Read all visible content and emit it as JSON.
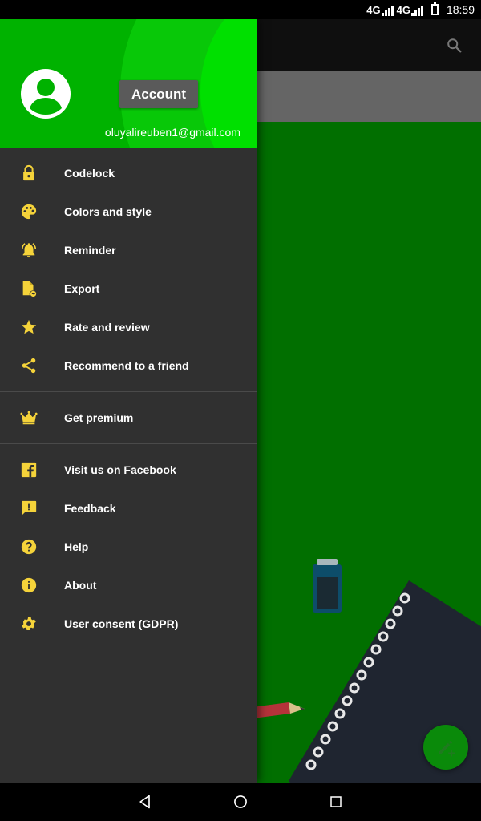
{
  "status_bar": {
    "network1": "4G",
    "network2": "4G",
    "time": "18:59"
  },
  "account": {
    "button_label": "Account",
    "email": "oluyalireuben1@gmail.com"
  },
  "menu": {
    "group1": [
      {
        "label": "Codelock",
        "icon": "lock-icon"
      },
      {
        "label": "Colors and style",
        "icon": "palette-icon"
      },
      {
        "label": "Reminder",
        "icon": "bell-icon"
      },
      {
        "label": "Export",
        "icon": "export-file-icon"
      },
      {
        "label": "Rate and review",
        "icon": "star-icon"
      },
      {
        "label": "Recommend to a friend",
        "icon": "share-icon"
      }
    ],
    "group2": [
      {
        "label": "Get premium",
        "icon": "crown-icon"
      }
    ],
    "group3": [
      {
        "label": "Visit us on Facebook",
        "icon": "facebook-icon"
      },
      {
        "label": "Feedback",
        "icon": "feedback-icon"
      },
      {
        "label": "Help",
        "icon": "help-icon"
      },
      {
        "label": "About",
        "icon": "info-icon"
      },
      {
        "label": "User consent (GDPR)",
        "icon": "gear-icon"
      }
    ]
  },
  "colors": {
    "accent_yellow": "#f5d33a",
    "header_green": "#00b200",
    "drawer_bg": "#303030",
    "app_green": "#016f00"
  }
}
